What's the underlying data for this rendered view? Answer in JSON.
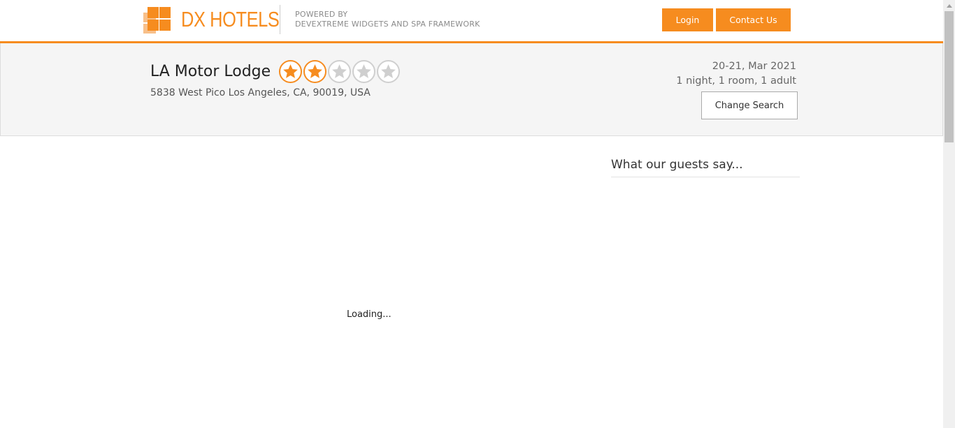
{
  "header": {
    "brand": "DX HOTELS",
    "powered_line1": "POWERED BY",
    "powered_line2": "DEVEXTREME WIDGETS AND SPA FRAMEWORK",
    "login_label": "Login",
    "contact_label": "Contact Us"
  },
  "hotel": {
    "name": "LA Motor Lodge",
    "rating": 2,
    "max_rating": 5,
    "address": "5838 West Pico Los Angeles, CA, 90019, USA"
  },
  "search": {
    "dates": "20-21, Mar 2021",
    "summary": "1 night, 1 room, 1 adult",
    "change_label": "Change Search"
  },
  "reviews": {
    "title": "What our guests say..."
  },
  "main": {
    "loading_text": "Loading..."
  },
  "colors": {
    "accent": "#f68c1f",
    "band_bg": "#f5f5f5"
  }
}
